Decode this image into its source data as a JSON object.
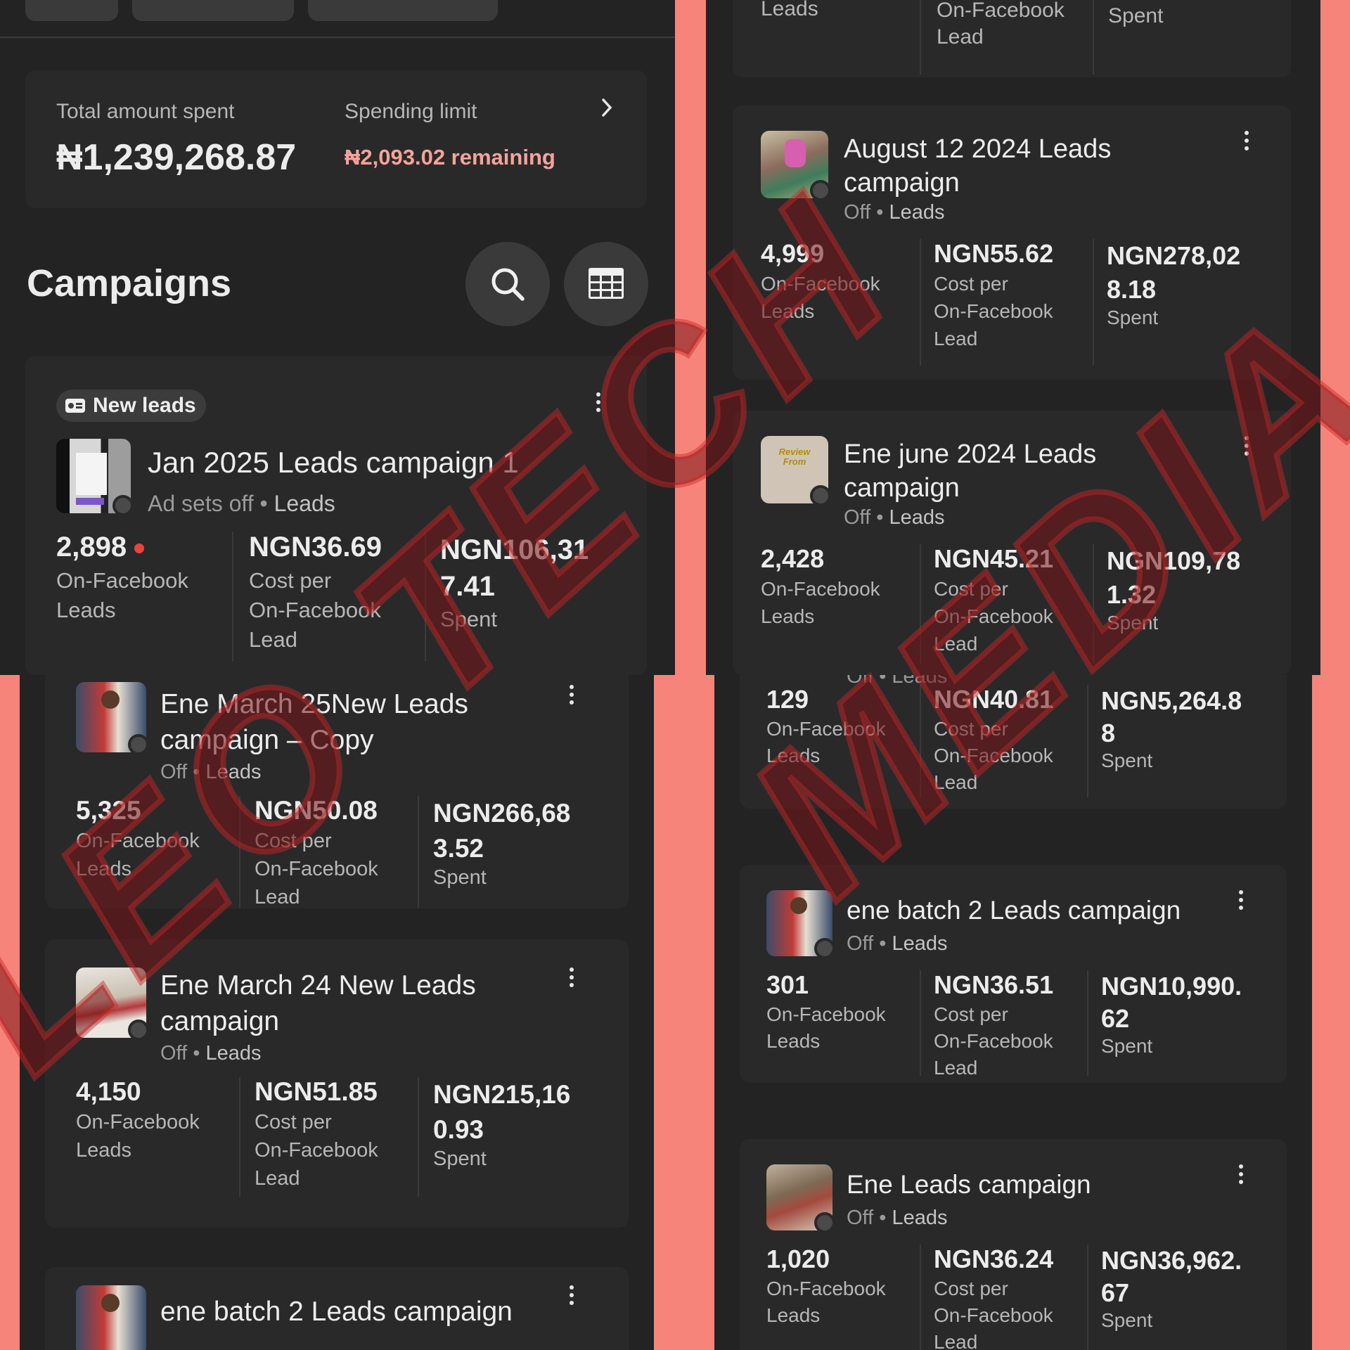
{
  "summary": {
    "total_label": "Total amount spent",
    "total_value": "₦1,239,268.87",
    "limit_label": "Spending limit",
    "limit_value": "₦2,093.02 remaining"
  },
  "section_title": "Campaigns",
  "icons": {
    "search": "search-icon",
    "table": "table-icon",
    "more": "more-vertical-icon",
    "chevron": "chevron-right-icon",
    "leads_badge": "lead-form-icon"
  },
  "badge": "New leads",
  "metric_labels": {
    "leads": [
      "On-Facebook",
      "Leads"
    ],
    "cpl": [
      "Cost per",
      "On-Facebook",
      "Lead"
    ],
    "spent": "Spent"
  },
  "left_campaigns": [
    {
      "name": "Jan 2025 Leads campaign 1",
      "status": "Ad sets off",
      "objective": "Leads",
      "leads": "2,898",
      "cpl": "NGN36.69",
      "spent": [
        "NGN106,31",
        "7.41"
      ]
    },
    {
      "name": [
        "Ene March 25New Leads",
        "campaign – Copy"
      ],
      "status": "Off",
      "objective": "Leads",
      "leads": "5,325",
      "cpl": "NGN50.08",
      "spent": [
        "NGN266,68",
        "3.52"
      ]
    },
    {
      "name": [
        "Ene March 24 New Leads",
        "campaign"
      ],
      "status": "Off",
      "objective": "Leads",
      "leads": "4,150",
      "cpl": "NGN51.85",
      "spent": [
        "NGN215,16",
        "0.93"
      ]
    },
    {
      "name": "ene batch 2 Leads campaign"
    }
  ],
  "right_campaigns": [
    {
      "partial_labels": [
        "Leads",
        "On-Facebook",
        "Lead",
        "Spent"
      ]
    },
    {
      "name": [
        "August 12 2024 Leads",
        "campaign"
      ],
      "status": "Off",
      "objective": "Leads",
      "leads": "4,999",
      "cpl": "NGN55.62",
      "spent": [
        "NGN278,02",
        "8.18"
      ]
    },
    {
      "name": [
        "Ene june 2024 Leads",
        "campaign"
      ],
      "status": "Off",
      "objective": "Leads",
      "leads": "2,428",
      "cpl": "NGN45.21",
      "spent": [
        "NGN109,78",
        "1.32"
      ]
    },
    {
      "status_partial": "Off • Leads",
      "leads": "129",
      "cpl": "NGN40.81",
      "spent": [
        "NGN5,264.8",
        "8"
      ]
    },
    {
      "name": "ene batch 2 Leads campaign",
      "status": "Off",
      "objective": "Leads",
      "leads": "301",
      "cpl": "NGN36.51",
      "spent": [
        "NGN10,990.",
        "62"
      ]
    },
    {
      "name": "Ene Leads campaign",
      "status": "Off",
      "objective": "Leads",
      "leads": "1,020",
      "cpl": "NGN36.24",
      "spent": [
        "NGN36,962.",
        "67"
      ]
    }
  ],
  "thumb_text": [
    "Review",
    "From"
  ],
  "watermark": [
    "LEO TECH",
    "MEDIA"
  ],
  "colors": {
    "bg": "#232324",
    "card": "#29292a",
    "accent": "#f7847a",
    "remaining": "#f6a39a",
    "dot": "#e8453a"
  }
}
